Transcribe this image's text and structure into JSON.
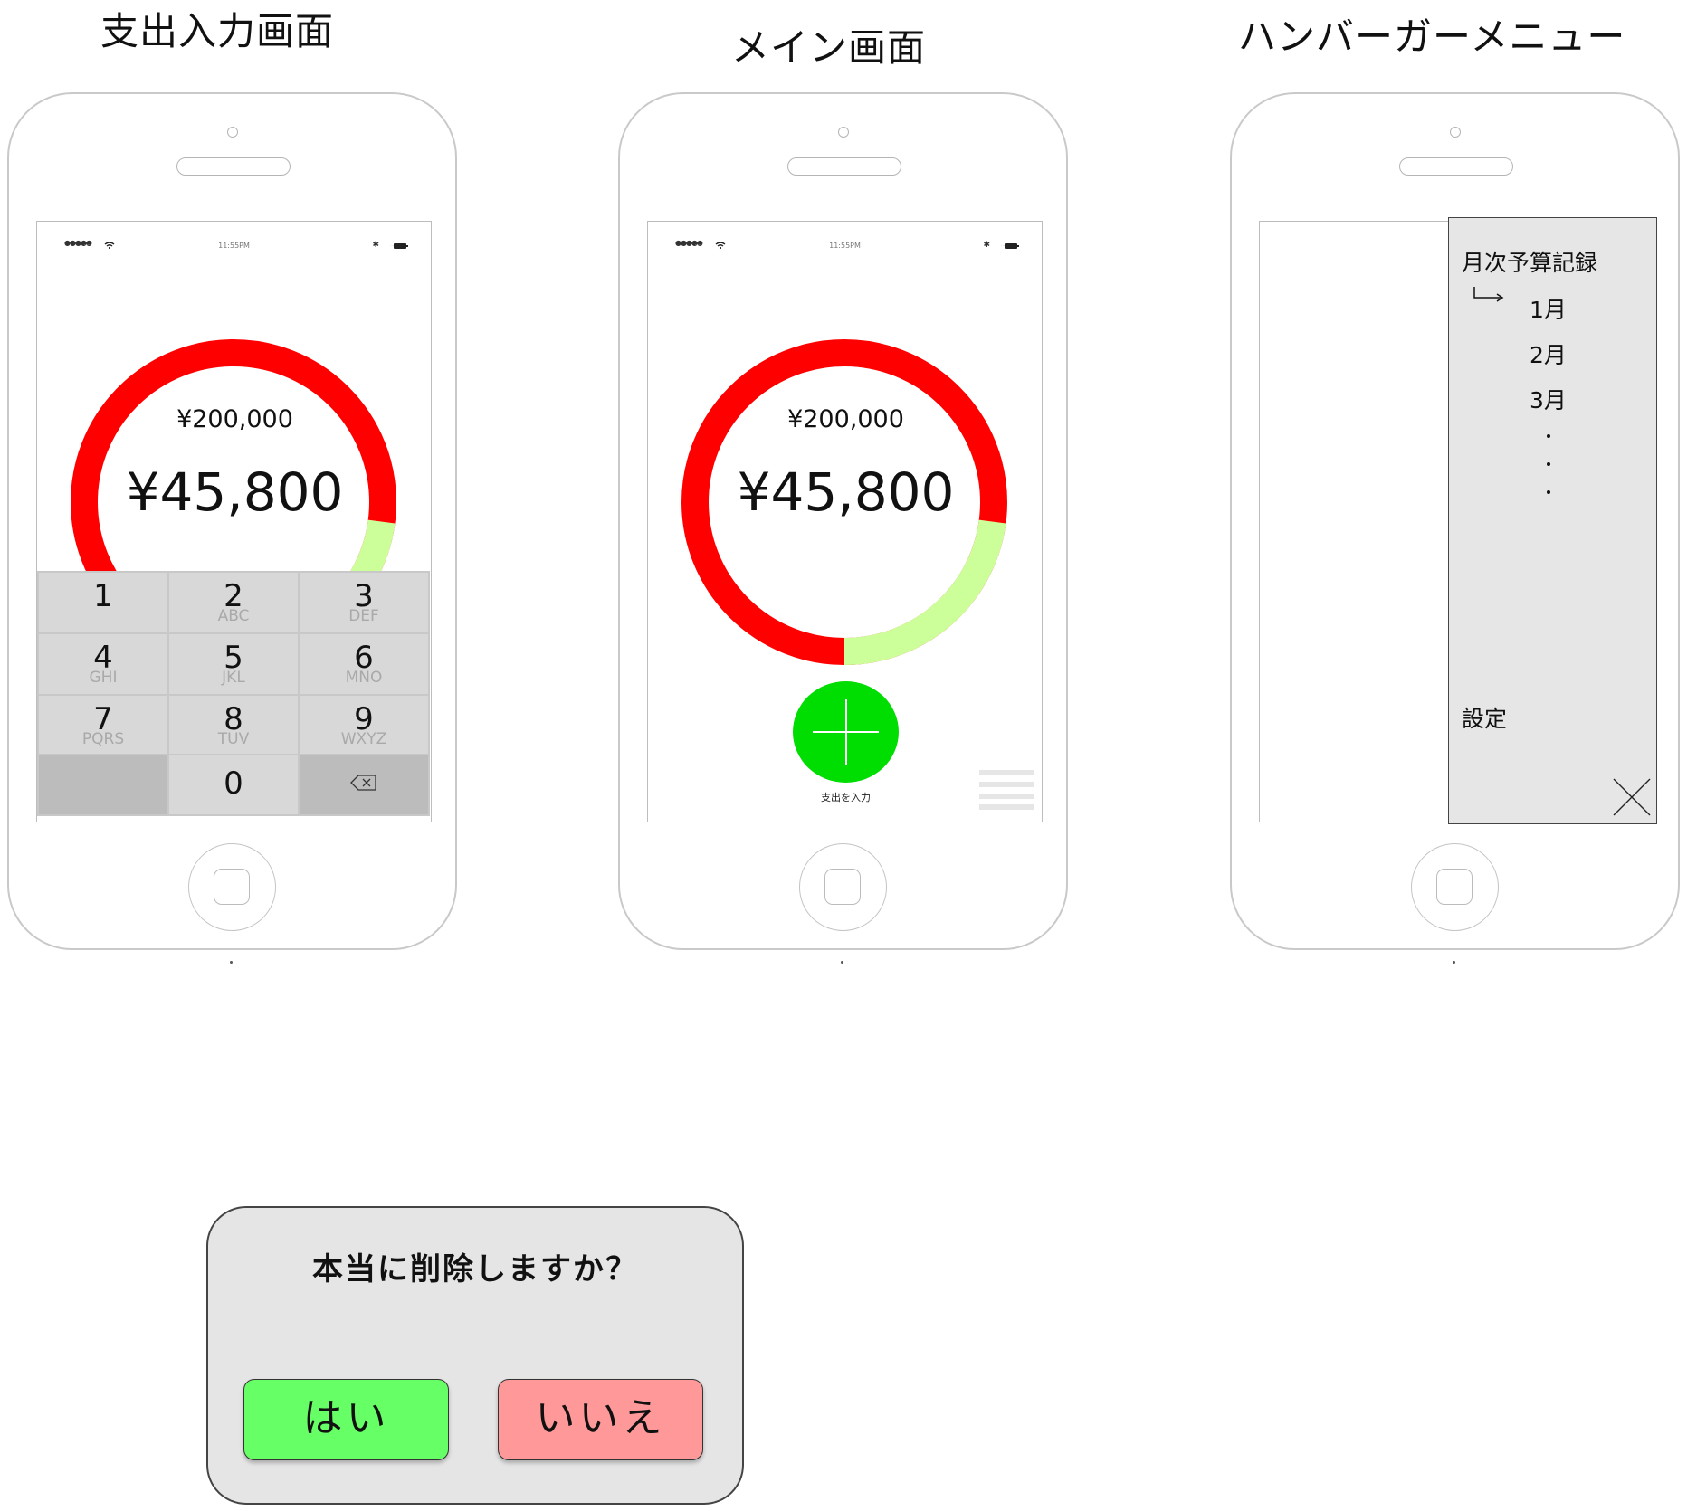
{
  "screens": {
    "expense_input": {
      "title": "支出入力画面",
      "budget_total": "¥200,000",
      "amount": "¥45,800",
      "keypad": {
        "keys": [
          {
            "digit": "1",
            "letters": ""
          },
          {
            "digit": "2",
            "letters": "ABC"
          },
          {
            "digit": "3",
            "letters": "DEF"
          },
          {
            "digit": "4",
            "letters": "GHI"
          },
          {
            "digit": "5",
            "letters": "JKL"
          },
          {
            "digit": "6",
            "letters": "MNO"
          },
          {
            "digit": "7",
            "letters": "PQRS"
          },
          {
            "digit": "8",
            "letters": "TUV"
          },
          {
            "digit": "9",
            "letters": "WXYZ"
          },
          {
            "digit": "0",
            "letters": ""
          }
        ],
        "delete_icon": "delete-backspace-icon"
      }
    },
    "main": {
      "title": "メイン画面",
      "budget_total": "¥200,000",
      "amount": "¥45,800",
      "add_button_label": "支出を入力",
      "add_button_icon": "plus-icon",
      "menu_icon": "hamburger-menu-icon"
    },
    "hamburger_menu": {
      "title": "ハンバーガーメニュー",
      "heading": "月次予算記録",
      "months": [
        "1月",
        "2月",
        "3月"
      ],
      "settings": "設定",
      "close_icon": "close-x-icon"
    }
  },
  "status_bar": {
    "time": "11:55PM"
  },
  "budget_ring": {
    "spent_fraction": 0.229,
    "spent_color": "#ccff99",
    "remaining_color": "#ff0000"
  },
  "confirm_dialog": {
    "message": "本当に削除しますか？",
    "yes_label": "はい",
    "no_label": "いいえ",
    "yes_color": "#66ff66",
    "no_color": "#ff9999"
  }
}
